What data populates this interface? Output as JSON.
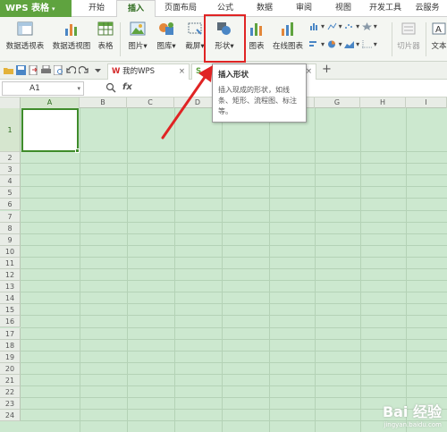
{
  "app": {
    "name": "WPS 表格"
  },
  "menu": {
    "tabs": [
      {
        "label": "开始"
      },
      {
        "label": "插入"
      },
      {
        "label": "页面布局"
      },
      {
        "label": "公式"
      },
      {
        "label": "数据"
      },
      {
        "label": "审阅"
      },
      {
        "label": "视图"
      },
      {
        "label": "开发工具"
      },
      {
        "label": "云服务"
      }
    ],
    "active": "插入"
  },
  "ribbon": {
    "pivot_table": "数据透视表",
    "pivot_chart": "数据透视图",
    "table": "表格",
    "picture": "图片",
    "gallery": "图库",
    "screenshot": "截屏",
    "shape": "形状",
    "chart": "图表",
    "online_chart": "在线图表",
    "slicer": "切片器",
    "text": "文本"
  },
  "doctabs": {
    "mywps": "我的WPS",
    "new_tab": "+"
  },
  "formula": {
    "cell_ref": "A1",
    "fx": "fx"
  },
  "tooltip": {
    "title": "插入形状",
    "body": "插入现成的形状，如线条、矩形、流程图、标注等。"
  },
  "columns": [
    "A",
    "B",
    "C",
    "D",
    "E",
    "F",
    "G",
    "H",
    "I"
  ],
  "rows": [
    "1",
    "2",
    "3",
    "4",
    "5",
    "6",
    "7",
    "8",
    "9",
    "10",
    "11",
    "12",
    "13",
    "14",
    "15",
    "16",
    "17",
    "18",
    "19",
    "20",
    "21",
    "22",
    "23",
    "24"
  ],
  "watermark": {
    "main": "Bai 经验",
    "url": "jingyan.baidu.com"
  },
  "colors": {
    "accent": "#5fa33f",
    "grid": "#cce8cf",
    "highlight": "#e02424"
  }
}
